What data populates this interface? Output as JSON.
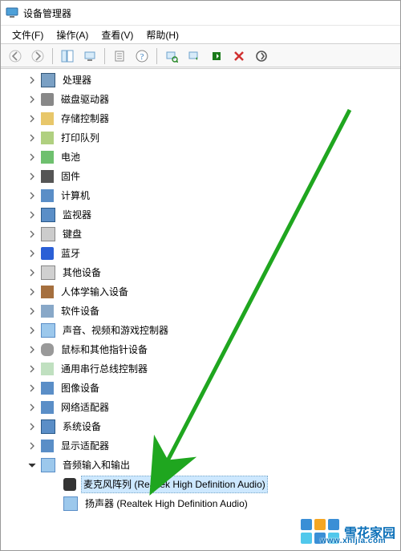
{
  "window": {
    "title": "设备管理器"
  },
  "menu": {
    "file": "文件(F)",
    "action": "操作(A)",
    "view": "查看(V)",
    "help": "帮助(H)"
  },
  "tree": {
    "categories": [
      {
        "label": "处理器",
        "icon": "ic-cpu",
        "expanded": false,
        "name": "category-processors"
      },
      {
        "label": "磁盘驱动器",
        "icon": "ic-disk",
        "expanded": false,
        "name": "category-disk-drives"
      },
      {
        "label": "存储控制器",
        "icon": "ic-storage",
        "expanded": false,
        "name": "category-storage-controllers"
      },
      {
        "label": "打印队列",
        "icon": "ic-printer",
        "expanded": false,
        "name": "category-print-queues"
      },
      {
        "label": "电池",
        "icon": "ic-battery",
        "expanded": false,
        "name": "category-batteries"
      },
      {
        "label": "固件",
        "icon": "ic-firmware",
        "expanded": false,
        "name": "category-firmware"
      },
      {
        "label": "计算机",
        "icon": "ic-computer",
        "expanded": false,
        "name": "category-computer"
      },
      {
        "label": "监视器",
        "icon": "ic-monitor",
        "expanded": false,
        "name": "category-monitors"
      },
      {
        "label": "键盘",
        "icon": "ic-keyboard",
        "expanded": false,
        "name": "category-keyboards"
      },
      {
        "label": "蓝牙",
        "icon": "ic-bt",
        "expanded": false,
        "name": "category-bluetooth"
      },
      {
        "label": "其他设备",
        "icon": "ic-other",
        "expanded": false,
        "name": "category-other-devices"
      },
      {
        "label": "人体学输入设备",
        "icon": "ic-hid",
        "expanded": false,
        "name": "category-hid"
      },
      {
        "label": "软件设备",
        "icon": "ic-soft",
        "expanded": false,
        "name": "category-software-devices"
      },
      {
        "label": "声音、视频和游戏控制器",
        "icon": "ic-sound",
        "expanded": false,
        "name": "category-sound-video-game"
      },
      {
        "label": "鼠标和其他指针设备",
        "icon": "ic-mouse",
        "expanded": false,
        "name": "category-mice"
      },
      {
        "label": "通用串行总线控制器",
        "icon": "ic-usb",
        "expanded": false,
        "name": "category-usb-controllers"
      },
      {
        "label": "图像设备",
        "icon": "ic-image",
        "expanded": false,
        "name": "category-imaging-devices"
      },
      {
        "label": "网络适配器",
        "icon": "ic-net",
        "expanded": false,
        "name": "category-network-adapters"
      },
      {
        "label": "系统设备",
        "icon": "ic-sys",
        "expanded": false,
        "name": "category-system-devices"
      },
      {
        "label": "显示适配器",
        "icon": "ic-display",
        "expanded": false,
        "name": "category-display-adapters"
      },
      {
        "label": "音频输入和输出",
        "icon": "ic-audio",
        "expanded": true,
        "name": "category-audio-io",
        "children": [
          {
            "label": "麦克风阵列 (Realtek High Definition Audio)",
            "icon": "ic-mic",
            "selected": true,
            "name": "device-microphone-array"
          },
          {
            "label": "扬声器 (Realtek High Definition Audio)",
            "icon": "ic-speaker",
            "selected": false,
            "name": "device-speakers"
          }
        ]
      }
    ]
  },
  "watermark": {
    "text": "雪花家园",
    "url": "www.xhijia.com"
  }
}
